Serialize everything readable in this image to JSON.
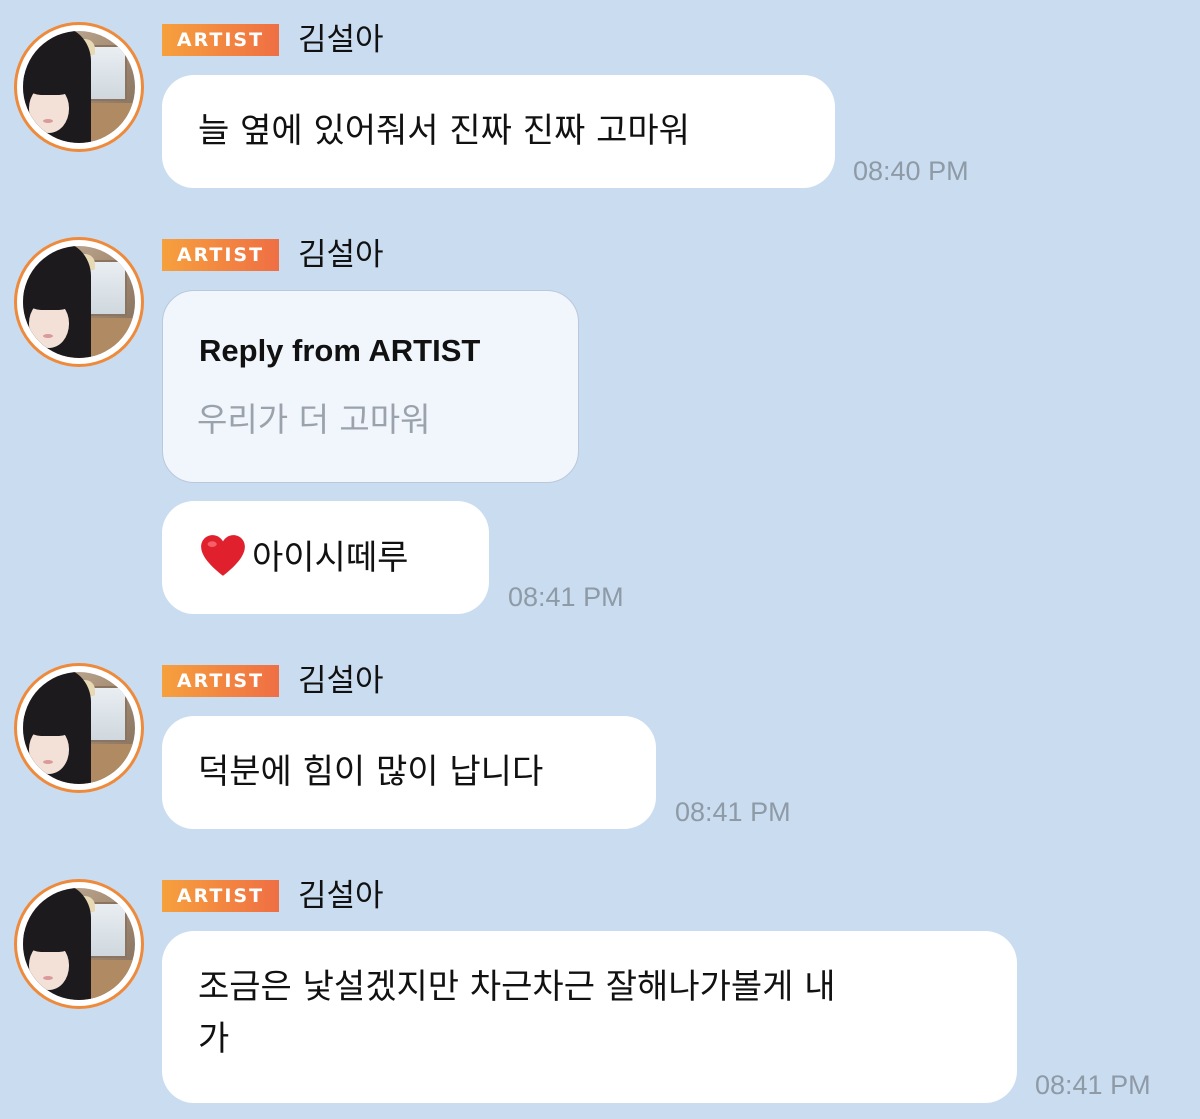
{
  "artist_badge": "ARTIST",
  "messages": [
    {
      "sender": "김설아",
      "text": "늘 옆에 있어줘서 진짜 진짜 고마워",
      "time": "08:40 PM"
    },
    {
      "sender": "김설아",
      "reply": {
        "title": "Reply from ARTIST",
        "quote": "우리가 더 고마워"
      },
      "emoji": "heart-icon",
      "text": "아이시떼루",
      "time": "08:41 PM"
    },
    {
      "sender": "김설아",
      "text": "덕분에 힘이 많이 납니다",
      "time": "08:41 PM"
    },
    {
      "sender": "김설아",
      "text_line1": "조금은 낯설겠지만 차근차근 잘해나가볼게 내",
      "text_line2": "가",
      "time": "08:41 PM"
    }
  ],
  "colors": {
    "background": "#cadcf0",
    "bubble": "#ffffff",
    "reply_bubble": "#f1f5fc",
    "badge_start": "#f6a03d",
    "badge_end": "#ef6f44",
    "avatar_ring": "#ee8a3c",
    "timestamp": "#8e9aa6"
  }
}
